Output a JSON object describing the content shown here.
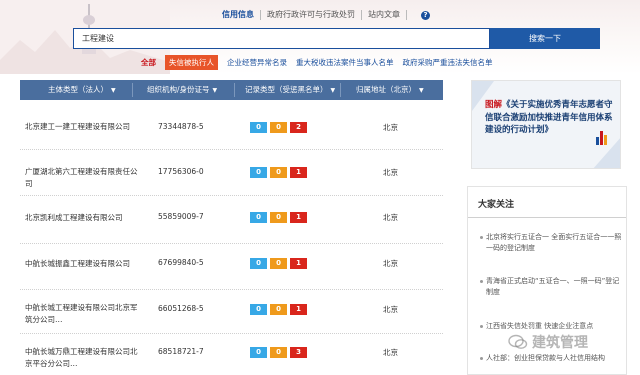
{
  "header": {
    "tabs": [
      {
        "label": "信用信息",
        "active": true
      },
      {
        "label": "政府行政许可与行政处罚",
        "active": false
      },
      {
        "label": "站内文章",
        "active": false
      }
    ],
    "help_icon": "?",
    "search_value": "工程建设",
    "search_button": "搜索一下"
  },
  "filters": [
    {
      "label": "全部"
    },
    {
      "label": "失信被执行人"
    },
    {
      "label": "企业经营异常名录"
    },
    {
      "label": "重大税收违法案件当事人名单"
    },
    {
      "label": "政府采购严重违法失信名单"
    }
  ],
  "table": {
    "columns": [
      "主体类型（法人）",
      "组织机构/身份证号",
      "记录类型（受惩黑名单）",
      "归属地址（北京）"
    ],
    "rows": [
      {
        "name": "北京建工一建工程建设有限公司",
        "code": "73344878-5",
        "counts": [
          "0",
          "0",
          "2"
        ],
        "region": "北京"
      },
      {
        "name": "广厦湖北第六工程建设有限责任公司",
        "code": "17756306-0",
        "counts": [
          "0",
          "0",
          "1"
        ],
        "region": "北京"
      },
      {
        "name": "北京凯利成工程建设有限公司",
        "code": "55859009-7",
        "counts": [
          "0",
          "0",
          "1"
        ],
        "region": "北京"
      },
      {
        "name": "中航长城振鑫工程建设有限公司",
        "code": "67699840-5",
        "counts": [
          "0",
          "0",
          "1"
        ],
        "region": "北京"
      },
      {
        "name": "中航长城工程建设有限公司北京军筑分公司…",
        "code": "66051268-5",
        "counts": [
          "0",
          "0",
          "1"
        ],
        "region": "北京"
      },
      {
        "name": "中航长城万鼎工程建设有限公司北京平谷分公司…",
        "code": "68518721-7",
        "counts": [
          "0",
          "0",
          "3"
        ],
        "region": "北京"
      }
    ]
  },
  "promo": {
    "prefix": "图解",
    "text": "《关于实施优秀青年志愿者守信联合激励加快推进青年信用体系建设的行动计划》"
  },
  "focus": {
    "title": "大家关注",
    "items": [
      "北京将实行五证合一 全面实行五证合一一照一码的登记制度",
      "青海省正式启动“五证合一、一照一码”登记制度",
      "江西省失信处罚重 快速企业注意点",
      "人社部：创业担保贷款与人社信用结构"
    ]
  },
  "watermark": "建筑管理",
  "colors": {
    "brand_blue": "#1f5aa7",
    "table_head": "#4a6e9e",
    "badge_blue": "#37a8e6",
    "badge_orange": "#ef9a1c",
    "badge_red": "#d9261c",
    "filter_selected": "#e8552a"
  }
}
